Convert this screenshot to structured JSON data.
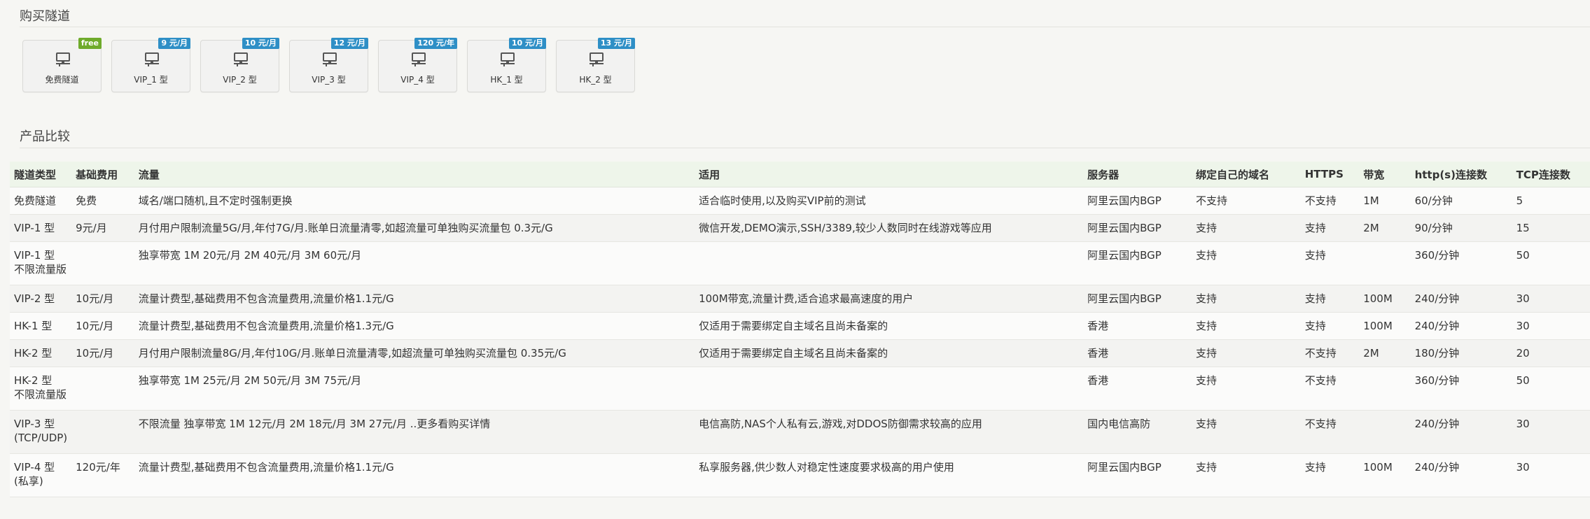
{
  "buy_section": {
    "title": "购买隧道",
    "cards": [
      {
        "label": "免费隧道",
        "badge": "free"
      },
      {
        "label": "VIP_1 型",
        "badge": "9 元/月"
      },
      {
        "label": "VIP_2 型",
        "badge": "10 元/月"
      },
      {
        "label": "VIP_3 型",
        "badge": "12 元/月"
      },
      {
        "label": "VIP_4 型",
        "badge": "120 元/年"
      },
      {
        "label": "HK_1 型",
        "badge": "10 元/月"
      },
      {
        "label": "HK_2 型",
        "badge": "13 元/月"
      }
    ]
  },
  "compare_section": {
    "title": "产品比较",
    "headers": [
      "隧道类型",
      "基础费用",
      "流量",
      "适用",
      "服务器",
      "绑定自己的域名",
      "HTTPS",
      "带宽",
      "http(s)连接数",
      "TCP连接数"
    ],
    "rows": [
      {
        "type": "免费隧道",
        "fee": "免费",
        "traffic": "域名/端口随机,且不定时强制更换",
        "usage": "适合临时使用,以及购买VIP前的测试",
        "server": "阿里云国内BGP",
        "domain": "不支持",
        "https": "不支持",
        "bw": "1M",
        "http": "60/分钟",
        "tcp": "5"
      },
      {
        "type": "VIP-1 型",
        "fee": "9元/月",
        "traffic": "月付用户限制流量5G/月,年付7G/月.账单日流量清零,如超流量可单独购买流量包 0.3元/G",
        "usage": "微信开发,DEMO演示,SSH/3389,较少人数同时在线游戏等应用",
        "server": "阿里云国内BGP",
        "domain": "支持",
        "https": "支持",
        "bw": "2M",
        "http": "90/分钟",
        "tcp": "15"
      },
      {
        "type": "VIP-1 型\n不限流量版",
        "fee": "",
        "traffic": "独享带宽 1M 20元/月 2M 40元/月 3M 60元/月",
        "usage": "",
        "server": "阿里云国内BGP",
        "domain": "支持",
        "https": "支持",
        "bw": "",
        "http": "360/分钟",
        "tcp": "50"
      },
      {
        "type": "VIP-2 型",
        "fee": "10元/月",
        "traffic": "流量计费型,基础费用不包含流量费用,流量价格1.1元/G",
        "usage": "100M带宽,流量计费,适合追求最高速度的用户",
        "server": "阿里云国内BGP",
        "domain": "支持",
        "https": "支持",
        "bw": "100M",
        "http": "240/分钟",
        "tcp": "30"
      },
      {
        "type": "HK-1 型",
        "fee": "10元/月",
        "traffic": "流量计费型,基础费用不包含流量费用,流量价格1.3元/G",
        "usage": "仅适用于需要绑定自主域名且尚未备案的",
        "server": "香港",
        "domain": "支持",
        "https": "支持",
        "bw": "100M",
        "http": "240/分钟",
        "tcp": "30"
      },
      {
        "type": "HK-2 型",
        "fee": "10元/月",
        "traffic": "月付用户限制流量8G/月,年付10G/月.账单日流量清零,如超流量可单独购买流量包 0.35元/G",
        "usage": "仅适用于需要绑定自主域名且尚未备案的",
        "server": "香港",
        "domain": "支持",
        "https": "不支持",
        "bw": "2M",
        "http": "180/分钟",
        "tcp": "20"
      },
      {
        "type": "HK-2 型\n不限流量版",
        "fee": "",
        "traffic": "独享带宽 1M 25元/月 2M 50元/月 3M 75元/月",
        "usage": "",
        "server": "香港",
        "domain": "支持",
        "https": "不支持",
        "bw": "",
        "http": "360/分钟",
        "tcp": "50"
      },
      {
        "type": "VIP-3 型\n(TCP/UDP)",
        "fee": "",
        "traffic": "不限流量 独享带宽 1M 12元/月 2M 18元/月 3M 27元/月 ..更多看购买详情",
        "usage": "电信高防,NAS个人私有云,游戏,对DDOS防御需求较高的应用",
        "server": "国内电信高防",
        "domain": "支持",
        "https": "不支持",
        "bw": "",
        "http": "240/分钟",
        "tcp": "30"
      },
      {
        "type": "VIP-4 型\n(私享)",
        "fee": "120元/年",
        "traffic": "流量计费型,基础费用不包含流量费用,流量价格1.1元/G",
        "usage": "私享服务器,供少数人对稳定性速度要求极高的用户使用",
        "server": "阿里云国内BGP",
        "domain": "支持",
        "https": "支持",
        "bw": "100M",
        "http": "240/分钟",
        "tcp": "30"
      }
    ]
  },
  "icons": {
    "card_icon": "monitor-network-icon"
  },
  "colors": {
    "badge": "#2e8fc6",
    "badge_free": "#6fab2b",
    "header_bg": "#eef5ea"
  }
}
